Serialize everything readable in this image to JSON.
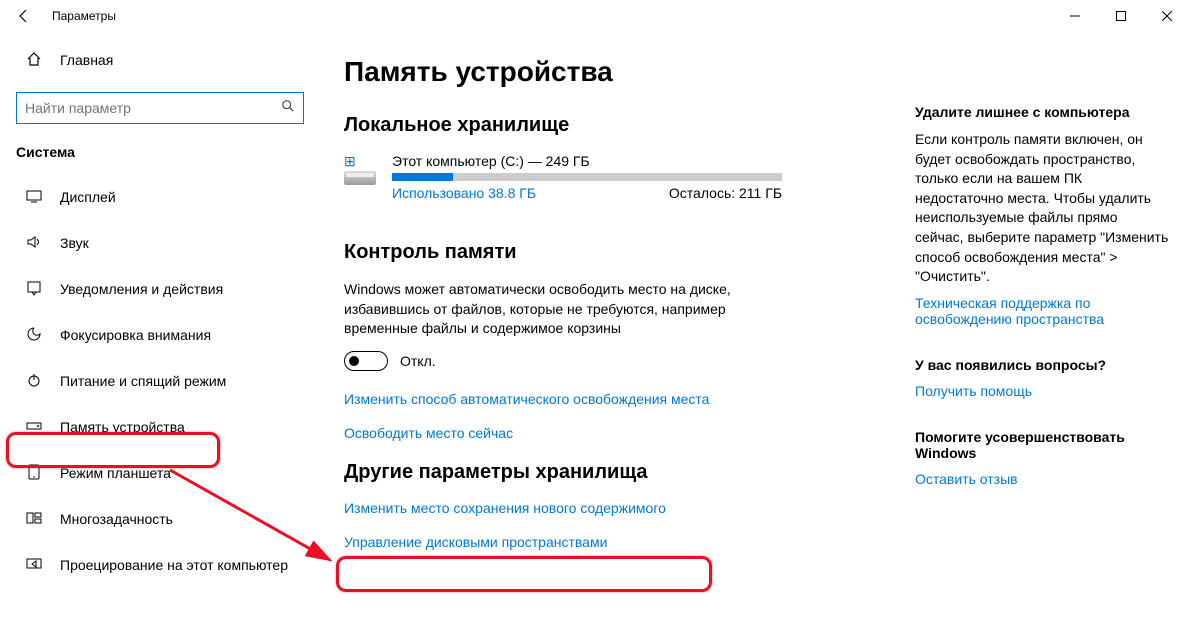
{
  "window": {
    "title": "Параметры"
  },
  "sidebar": {
    "home": "Главная",
    "search_placeholder": "Найти параметр",
    "group": "Система",
    "items": [
      {
        "label": "Дисплей"
      },
      {
        "label": "Звук"
      },
      {
        "label": "Уведомления и действия"
      },
      {
        "label": "Фокусировка внимания"
      },
      {
        "label": "Питание и спящий режим"
      },
      {
        "label": "Память устройства"
      },
      {
        "label": "Режим планшета"
      },
      {
        "label": "Многозадачность"
      },
      {
        "label": "Проецирование на этот компьютер"
      }
    ]
  },
  "main": {
    "title": "Память устройства",
    "local_storage_heading": "Локальное хранилище",
    "drive_label": "Этот компьютер (C:) — 249 ГБ",
    "used_label": "Использовано 38.8 ГБ",
    "remaining_label": "Осталось: 211 ГБ",
    "storage_sense_heading": "Контроль памяти",
    "storage_sense_desc": "Windows может автоматически освободить место на диске, избавившись от файлов, которые не требуются, например временные файлы и содержимое корзины",
    "toggle_state": "Откл.",
    "link_change_auto": "Изменить способ автоматического освобождения места",
    "link_free_now": "Освободить место сейчас",
    "other_heading": "Другие параметры хранилища",
    "link_change_location": "Изменить место сохранения нового содержимого",
    "link_manage_spaces": "Управление дисковыми пространствами"
  },
  "aside": {
    "cleanup_heading": "Удалите лишнее с компьютера",
    "cleanup_desc": "Если контроль памяти включен, он будет освобождать пространство, только если на вашем ПК недостаточно места. Чтобы удалить неиспользуемые файлы прямо сейчас, выберите параметр \"Изменить способ освобождения места\" > \"Очистить\".",
    "cleanup_link": "Техническая поддержка по освобождению пространства",
    "questions_heading": "У вас появились вопросы?",
    "questions_link": "Получить помощь",
    "improve_heading": "Помогите усовершенствовать Windows",
    "improve_link": "Оставить отзыв"
  }
}
